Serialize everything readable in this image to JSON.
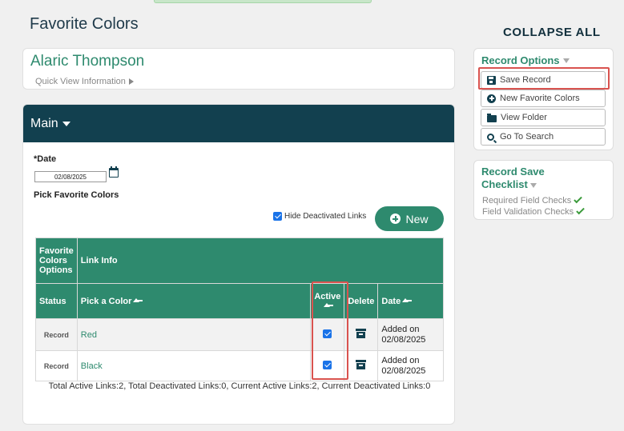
{
  "page": {
    "title": "Favorite Colors",
    "collapse_all": "COLLAPSE ALL"
  },
  "record": {
    "name": "Alaric Thompson",
    "quick_view": "Quick View Information"
  },
  "main": {
    "header": "Main",
    "date_label": "*Date",
    "date_value": "02/08/2025",
    "pick_label": "Pick Favorite Colors",
    "hide_deactivated_label": "Hide Deactivated Links",
    "hide_deactivated_checked": true,
    "new_button": "New",
    "table": {
      "group_header": "Favorite Colors Options",
      "link_info_header": "Link Info",
      "columns": [
        "Status",
        "Pick a Color",
        "Active",
        "Delete",
        "Date"
      ],
      "rows": [
        {
          "status": "Record",
          "color": "Red",
          "active": true,
          "date_line1": "Added on",
          "date_line2": "02/08/2025"
        },
        {
          "status": "Record",
          "color": "Black",
          "active": true,
          "date_line1": "Added on",
          "date_line2": "02/08/2025"
        }
      ]
    },
    "totals": "Total Active Links:2, Total Deactivated Links:0, Current Active Links:2, Current Deactivated Links:0"
  },
  "record_options": {
    "title": "Record Options",
    "buttons": [
      {
        "label": "Save Record",
        "icon": "save-icon"
      },
      {
        "label": "New Favorite Colors",
        "icon": "plus-circle-icon"
      },
      {
        "label": "View Folder",
        "icon": "folder-icon"
      },
      {
        "label": "Go To Search",
        "icon": "search-icon"
      }
    ]
  },
  "checklist": {
    "title": "Record Save Checklist",
    "items": [
      "Required Field Checks",
      "Field Validation Checks"
    ]
  },
  "colors": {
    "accent": "#2e8a6e",
    "header": "#12404f",
    "highlight": "#d9534f"
  }
}
